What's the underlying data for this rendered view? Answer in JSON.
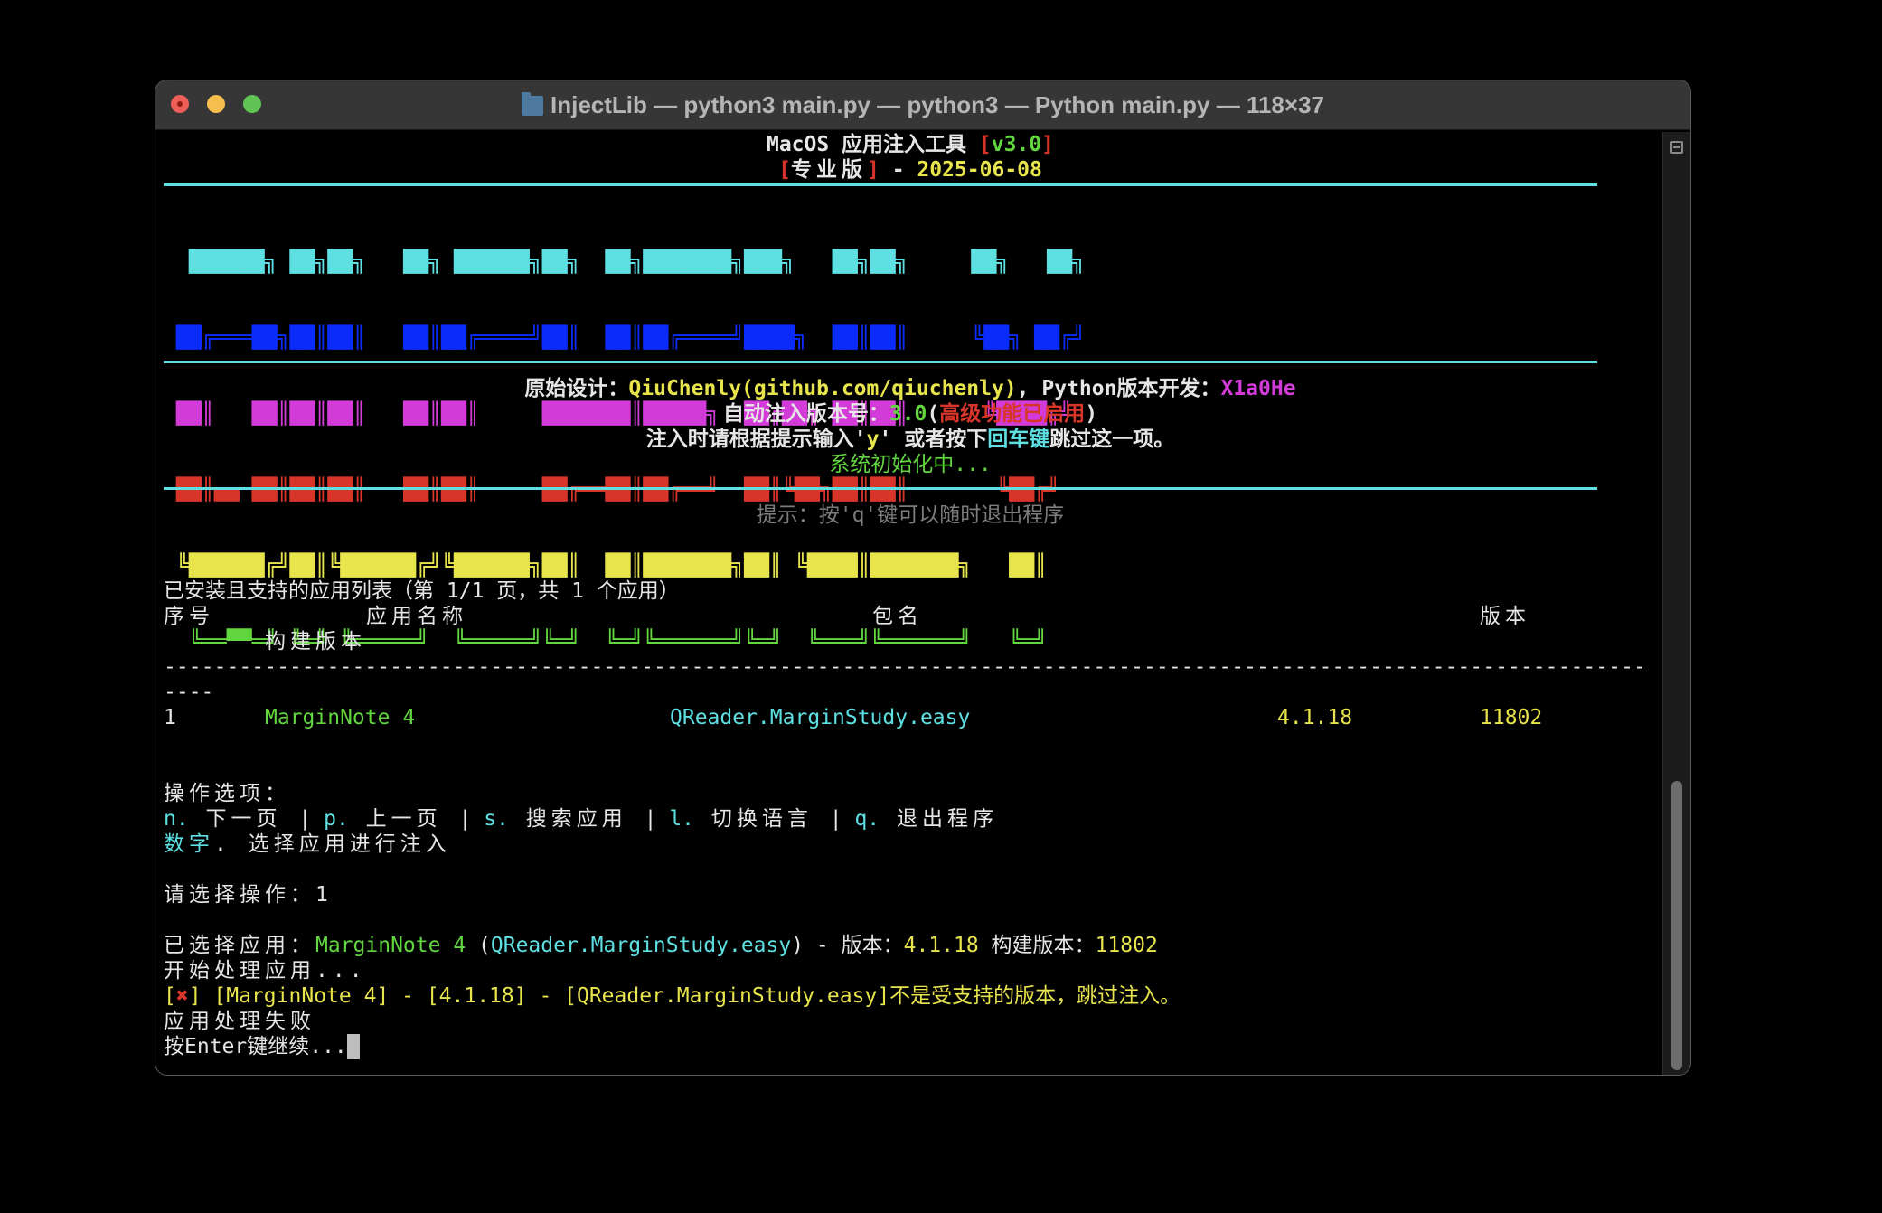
{
  "window": {
    "title": "InjectLib — python3 main.py — python3 — Python main.py — 118×37"
  },
  "header": {
    "app_name": "MacOS 应用注入工具 ",
    "version_open": "[",
    "version": "v3.0",
    "version_close": "]",
    "edition_open": "[",
    "edition": "专业版",
    "edition_close": "]",
    "date_sep": " - ",
    "date": "2025-06-08"
  },
  "banner": {
    "lines": [
      " ██████╗ ██╗██╗   ██╗ ██████╗██╗  ██╗███████╗███╗   ██╗██╗     ██╗   ██╗",
      "██╔═══██╗██║██║   ██║██╔════╝██║  ██║██╔════╝████╗  ██║██║     ╚██╗ ██╔╝",
      "██║   ██║██║██║   ██║██║     ███████║█████╗  ██╔██╗ ██║██║      ╚████╔╝ ",
      "██║▄▄ ██║██║██║   ██║██║     ██╔══██║██╔══╝  ██║╚██╗██║██║       ╚██╔╝  ",
      "╚██████╔╝██║╚██████╔╝╚██████╗██║  ██║███████╗██║ ╚████║███████╗   ██║   ",
      " ╚══▀▀═╝ ╚═╝ ╚═════╝  ╚═════╝╚═╝  ╚═╝╚══════╝╚═╝  ╚═══╝╚══════╝   ╚═╝   "
    ]
  },
  "credits": {
    "design_label": "原始设计：",
    "design_author": "QiuChenly(github.com/qiuchenly)",
    "dev_label": ", Python版本开发：",
    "dev_author": "X1a0He",
    "auto_label": "自动注入版本号：",
    "auto_version": "3.0",
    "paren_open": "(",
    "advanced": "高级功能已启用",
    "paren_close": ")",
    "hint_a": "注入时请根据提示输入'",
    "hint_y": "y",
    "hint_b": "' 或者按下",
    "hint_enter": "回车键",
    "hint_c": "跳过这一项。",
    "init": "系统初始化中..."
  },
  "quit_hint": "提示：按'q'键可以随时退出程序",
  "list": {
    "title": "已安装且支持的应用列表（第 1/1 页，共 1 个应用）",
    "headers": {
      "index": "序号",
      "name": "应用名称",
      "bundle": "包名",
      "version": "版本",
      "build": "构建版本"
    },
    "separator": "----------------------------------------------------------------------------------------------------------------------",
    "separator_wrap": "----",
    "rows": [
      {
        "index": "1",
        "name": "MarginNote 4",
        "bundle": "QReader.MarginStudy.easy",
        "version": "4.1.18",
        "build": "11802"
      }
    ]
  },
  "options": {
    "title": "操作选项：",
    "items": [
      {
        "key": "n.",
        "label": " 下一页 "
      },
      {
        "key": "p.",
        "label": " 上一页 "
      },
      {
        "key": "s.",
        "label": " 搜索应用 "
      },
      {
        "key": "l.",
        "label": " 切换语言 "
      },
      {
        "key": "q.",
        "label": " 退出程序"
      }
    ],
    "sep": "| ",
    "number_key": "数字",
    "number_label": ". 选择应用进行注入"
  },
  "prompt": {
    "label": "请选择操作：",
    "value": "1"
  },
  "log": {
    "selected_label": "已选择应用：",
    "selected_name": "MarginNote 4",
    "selected_bundle_open": " (",
    "selected_bundle": "QReader.MarginStudy.easy",
    "selected_mid": ") - 版本：",
    "selected_version": "4.1.18",
    "selected_build_label": " 构建版本：",
    "selected_build": "11802",
    "processing": "开始处理应用...",
    "error_open": "[",
    "error_icon": "✖",
    "error_text": "] [MarginNote 4] - [4.1.18] - [QReader.MarginStudy.easy]不是受支持的版本，跳过注入。",
    "failed": "应用处理失败",
    "continue": "按Enter键继续..."
  }
}
